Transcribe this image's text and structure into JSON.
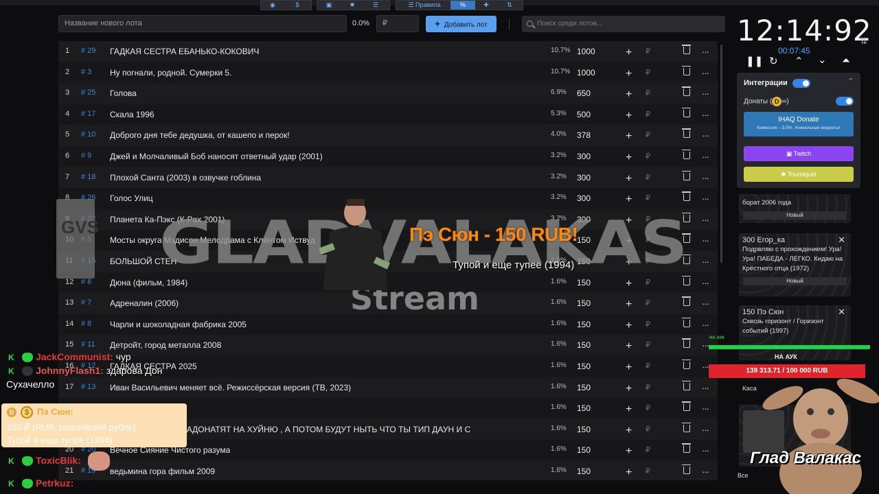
{
  "toolbar": {
    "new_lot_placeholder": "Название нового лота",
    "percent": "0.0%",
    "price_placeholder": "₽",
    "add_button": "Добавить лот",
    "search_placeholder": "Поиск среди лотов..."
  },
  "lots": [
    {
      "idx": "1",
      "id": "# 29",
      "name": "ГАДКАЯ СЕСТРА ЕБАНЬКО-КОКОВИЧ",
      "pct": "10.7%",
      "amount": "1000"
    },
    {
      "idx": "2",
      "id": "# 3",
      "name": "Ну погнали, родной. Сумерки 5.",
      "pct": "10.7%",
      "amount": "1000"
    },
    {
      "idx": "3",
      "id": "# 25",
      "name": "Голова",
      "pct": "6.9%",
      "amount": "650"
    },
    {
      "idx": "4",
      "id": "# 17",
      "name": "Скала 1996",
      "pct": "5.3%",
      "amount": "500"
    },
    {
      "idx": "5",
      "id": "# 10",
      "name": "Доброго дня тебе дедушка, от кашепо и перок!",
      "pct": "4.0%",
      "amount": "378"
    },
    {
      "idx": "6",
      "id": "# 9",
      "name": "Джей и Молчаливый Боб наносят ответный удар (2001)",
      "pct": "3.2%",
      "amount": "300"
    },
    {
      "idx": "7",
      "id": "# 18",
      "name": "Плохой Санта (2003) в озвучке гоблина",
      "pct": "3.2%",
      "amount": "300"
    },
    {
      "idx": "8",
      "id": "# 26",
      "name": "Голос Улиц",
      "pct": "3.2%",
      "amount": "300"
    },
    {
      "idx": "9",
      "id": "# 22",
      "name": "Планета Ка-Пэкс (К-Pax 2001)",
      "pct": "3.2%",
      "amount": "300"
    },
    {
      "idx": "10",
      "id": "# 5",
      "name": "Мосты округа Мэдисон Мелодрама с Клинтом Иствуд",
      "pct": "1.6%",
      "amount": "150"
    },
    {
      "idx": "11",
      "id": "# 15",
      "name": "БОЛЬШОЙ СТЕН",
      "pct": "1.6%",
      "amount": "150"
    },
    {
      "idx": "12",
      "id": "# 6",
      "name": "Дюна (фильм, 1984)",
      "pct": "1.6%",
      "amount": "150"
    },
    {
      "idx": "13",
      "id": "# 7",
      "name": "Адреналин (2006)",
      "pct": "1.6%",
      "amount": "150"
    },
    {
      "idx": "14",
      "id": "# 8",
      "name": "Чарли и шоколадная фабрика 2005",
      "pct": "1.6%",
      "amount": "150"
    },
    {
      "idx": "15",
      "id": "# 11",
      "name": "Детройт, город металла 2008",
      "pct": "1.6%",
      "amount": "150"
    },
    {
      "idx": "16",
      "id": "# 12",
      "name": "ГАДКАЯ СЕСТРА 2025",
      "pct": "1.6%",
      "amount": "150"
    },
    {
      "idx": "17",
      "id": "# 13",
      "name": "Иван Васильевич меняет всё. Режиссёрская версия (ТВ, 2023)",
      "pct": "1.6%",
      "amount": "150"
    },
    {
      "idx": "18",
      "id": "# 14",
      "name": "",
      "pct": "1.6%",
      "amount": "150"
    },
    {
      "idx": "19",
      "id": "# 16",
      "name": "ЩАС ДОЛБОЕБЫ НАДОНАТЯТ НА ХУЙНЮ , А ПОТОМ БУДУТ НЫТЬ ЧТО ТЫ ТИП ДАУН И С",
      "pct": "1.6%",
      "amount": "150"
    },
    {
      "idx": "20",
      "id": "# 20",
      "name": "Вечное Сияние Чистого разума",
      "pct": "1.6%",
      "amount": "150"
    },
    {
      "idx": "21",
      "id": "# 19",
      "name": "ведьмина гора фильм 2009",
      "pct": "1.6%",
      "amount": "150"
    }
  ],
  "row_symbols": {
    "plus": "+",
    "rub": "₽",
    "more": "···"
  },
  "timer": {
    "main": "12:14:92",
    "sub": "00:07:45"
  },
  "integrations": {
    "title": "Интеграции",
    "donaty_label": "Донаты (",
    "donaty_suffix": "∞)",
    "ihaq_title": "IHAQ Donate",
    "ihaq_sub": "Комиссия – 3,5%. Уникальные виджеты!",
    "twitch": "Twitch",
    "tourniquet": "Tourniquet"
  },
  "donation_cards": [
    {
      "title": "",
      "text": "борат 2006 года",
      "select": "Новый"
    },
    {
      "title": "300 Егор_ка",
      "text": "Подрвляю с прохождением! Ура! Ура! ПАБЕДА - ЛЕГКО. Кидаю на Крёстного отца (1972)",
      "select": "Новый"
    },
    {
      "title": "150 Пэ Сюн",
      "text": "Сквозь горизонт / Горизонт событий (1997)",
      "select": "Новый"
    }
  ],
  "goal": {
    "label_small": "НА АУК",
    "label": "НА АУК",
    "progress": "139 313.71 / 100 000 RUB",
    "fill": 1.0
  },
  "overlay": {
    "logo_letters": "GVS",
    "brand": "GLADVALAKAS",
    "stream": "Stream",
    "alert": "Пэ Сюн - 150 RUB!",
    "alert_sub": "Тупой и еще тупее (1994)",
    "corner_name": "Глад Валакас",
    "partial_kasa": "Каса",
    "partial_vse": "Все"
  },
  "chat": [
    {
      "badge": "K",
      "user": "JackCommunist:",
      "text": "чур"
    },
    {
      "badge": "K",
      "user": "JohnnyFlash1:",
      "text": "здарова Дон"
    },
    {
      "badge": "",
      "user": "",
      "text": "Сухачелло"
    }
  ],
  "chat_donation": {
    "name": "Пэ Сюн:",
    "amount": "150 ₽ (RUB, российский рубль)",
    "message": "Тупой и еще тупее (1994)"
  },
  "chat_after": [
    {
      "badge": "K",
      "user": "ToxicBlik:",
      "text": ""
    },
    {
      "badge": "K",
      "user": "Petrkuz:",
      "text": ""
    }
  ],
  "bottom_bar": {
    "rules": "Правила",
    "percent_icon": "%",
    "dollar_icon": "$"
  },
  "colors": {
    "accent": "#5aa0ef",
    "id_blue": "#3d86d6",
    "alert_orange": "#f28a1f",
    "goal_green": "#1ed04a",
    "goal_red": "#e0232c",
    "twitch": "#8b45f0",
    "tourniquet": "#c8cc48"
  }
}
